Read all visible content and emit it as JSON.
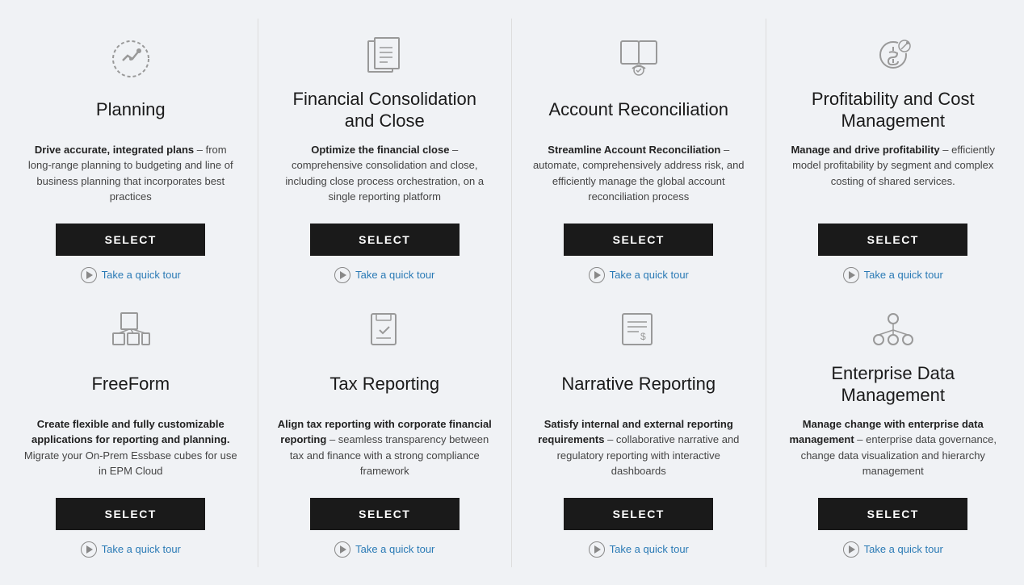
{
  "cards": [
    {
      "id": "planning",
      "title": "Planning",
      "description_bold": "Drive accurate, integrated plans",
      "description_rest": " – from long-range planning to budgeting and line of business planning that incorporates best practices",
      "select_label": "SELECT",
      "tour_label": "Take a quick tour",
      "icon": "planning"
    },
    {
      "id": "financial-consolidation",
      "title": "Financial Consolidation and Close",
      "description_bold": "Optimize the financial close",
      "description_rest": " – comprehensive consolidation and close, including close process orchestration, on a single reporting platform",
      "select_label": "SELECT",
      "tour_label": "Take a quick tour",
      "icon": "financial"
    },
    {
      "id": "account-reconciliation",
      "title": "Account Reconciliation",
      "description_bold": "Streamline Account Reconciliation",
      "description_rest": " – automate, comprehensively address risk, and efficiently manage the global account reconciliation process",
      "select_label": "SELECT",
      "tour_label": "Take a quick tour",
      "icon": "reconciliation"
    },
    {
      "id": "profitability",
      "title": "Profitability and Cost Management",
      "description_bold": "Manage and drive profitability",
      "description_rest": " – efficiently model profitability by segment and complex costing of shared services.",
      "select_label": "SELECT",
      "tour_label": "Take a quick tour",
      "icon": "profitability"
    },
    {
      "id": "freeform",
      "title": "FreeForm",
      "description_bold": "Create flexible and fully customizable applications for reporting and planning.",
      "description_rest": " Migrate your On-Prem Essbase cubes for use in EPM Cloud",
      "select_label": "SELECT",
      "tour_label": "Take a quick tour",
      "icon": "freeform"
    },
    {
      "id": "tax-reporting",
      "title": "Tax Reporting",
      "description_bold": "Align tax reporting with corporate financial reporting",
      "description_rest": " – seamless transparency between tax and finance with a strong compliance framework",
      "select_label": "SELECT",
      "tour_label": "Take a quick tour",
      "icon": "tax"
    },
    {
      "id": "narrative-reporting",
      "title": "Narrative Reporting",
      "description_bold": "Satisfy internal and external reporting requirements",
      "description_rest": " – collaborative narrative and regulatory reporting with interactive dashboards",
      "select_label": "SELECT",
      "tour_label": "Take a quick tour",
      "icon": "narrative"
    },
    {
      "id": "enterprise-data",
      "title": "Enterprise Data Management",
      "description_bold": "Manage change with enterprise data management",
      "description_rest": " – enterprise data governance, change data visualization and hierarchy management",
      "select_label": "SELECT",
      "tour_label": "Take a quick tour",
      "icon": "enterprise"
    }
  ]
}
